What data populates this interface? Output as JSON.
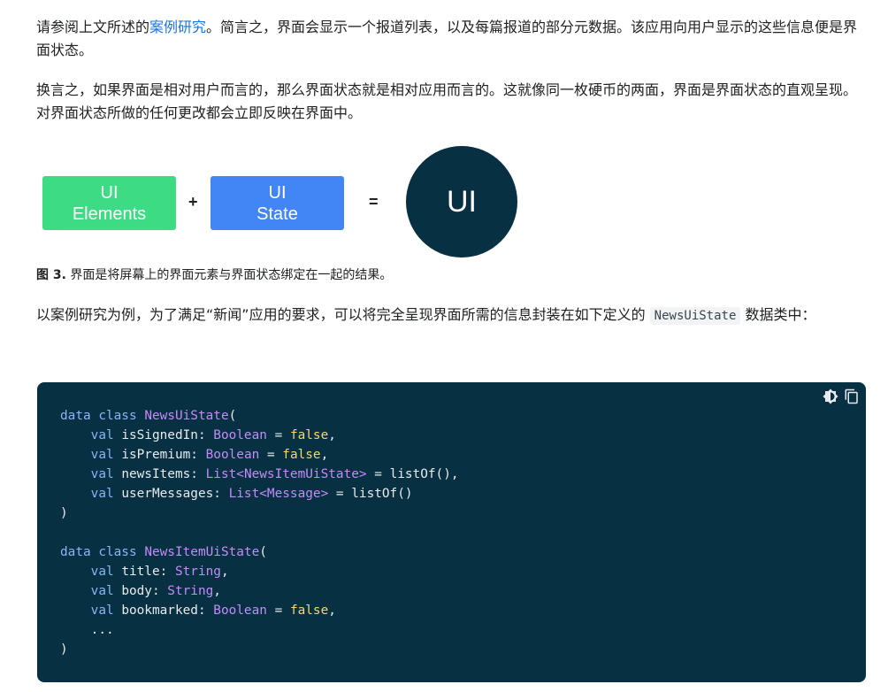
{
  "paragraph1": {
    "before_link": "请参阅上文所述的",
    "link_text": "案例研究",
    "after_link": "。简言之，界面会显示一个报道列表，以及每篇报道的部分元数据。该应用向用户显示的这些信息便是界面状态。"
  },
  "paragraph2": "换言之，如果界面是相对用户而言的，那么界面状态就是相对应用而言的。这就像同一枚硬币的两面，界面是界面状态的直观呈现。对界面状态所做的任何更改都会立即反映在界面中。",
  "figure": {
    "box1_line1": "UI",
    "box1_line2": "Elements",
    "plus": "+",
    "box2_line1": "UI",
    "box2_line2": "State",
    "equals": "=",
    "result": "UI",
    "colors": {
      "elements": "#3ddc84",
      "state": "#4285f4",
      "result": "#073042"
    }
  },
  "caption": {
    "label": "图 3.",
    "text": " 界面是将屏幕上的界面元素与界面状态绑定在一起的结果。"
  },
  "paragraph3": {
    "before_code": "以案例研究为例，为了满足“新闻”应用的要求，可以将完全呈现界面所需的信息封装在如下定义的 ",
    "inline_code": "NewsUiState",
    "after_code": " 数据类中："
  },
  "code_block": {
    "tools": [
      "theme-toggle-icon",
      "copy-icon"
    ],
    "lines": [
      [
        [
          "kw",
          "data class "
        ],
        [
          "ty",
          "NewsUiState"
        ],
        [
          "p",
          "("
        ]
      ],
      [
        [
          "p",
          "    "
        ],
        [
          "kw",
          "val "
        ],
        [
          "p",
          "isSignedIn: "
        ],
        [
          "ty",
          "Boolean"
        ],
        [
          "p",
          " = "
        ],
        [
          "lit",
          "false"
        ],
        [
          "p",
          ","
        ]
      ],
      [
        [
          "p",
          "    "
        ],
        [
          "kw",
          "val "
        ],
        [
          "p",
          "isPremium: "
        ],
        [
          "ty",
          "Boolean"
        ],
        [
          "p",
          " = "
        ],
        [
          "lit",
          "false"
        ],
        [
          "p",
          ","
        ]
      ],
      [
        [
          "p",
          "    "
        ],
        [
          "kw",
          "val "
        ],
        [
          "p",
          "newsItems: "
        ],
        [
          "ty",
          "List<NewsItemUiState>"
        ],
        [
          "p",
          " = listOf(),"
        ]
      ],
      [
        [
          "p",
          "    "
        ],
        [
          "kw",
          "val "
        ],
        [
          "p",
          "userMessages: "
        ],
        [
          "ty",
          "List<Message>"
        ],
        [
          "p",
          " = listOf()"
        ]
      ],
      [
        [
          "p",
          ")"
        ]
      ],
      [
        [
          "p",
          ""
        ]
      ],
      [
        [
          "kw",
          "data class "
        ],
        [
          "ty",
          "NewsItemUiState"
        ],
        [
          "p",
          "("
        ]
      ],
      [
        [
          "p",
          "    "
        ],
        [
          "kw",
          "val "
        ],
        [
          "p",
          "title: "
        ],
        [
          "ty",
          "String"
        ],
        [
          "p",
          ","
        ]
      ],
      [
        [
          "p",
          "    "
        ],
        [
          "kw",
          "val "
        ],
        [
          "p",
          "body: "
        ],
        [
          "ty",
          "String"
        ],
        [
          "p",
          ","
        ]
      ],
      [
        [
          "p",
          "    "
        ],
        [
          "kw",
          "val "
        ],
        [
          "p",
          "bookmarked: "
        ],
        [
          "ty",
          "Boolean"
        ],
        [
          "p",
          " = "
        ],
        [
          "lit",
          "false"
        ],
        [
          "p",
          ","
        ]
      ],
      [
        [
          "p",
          "    ..."
        ]
      ],
      [
        [
          "p",
          ")"
        ]
      ]
    ]
  }
}
